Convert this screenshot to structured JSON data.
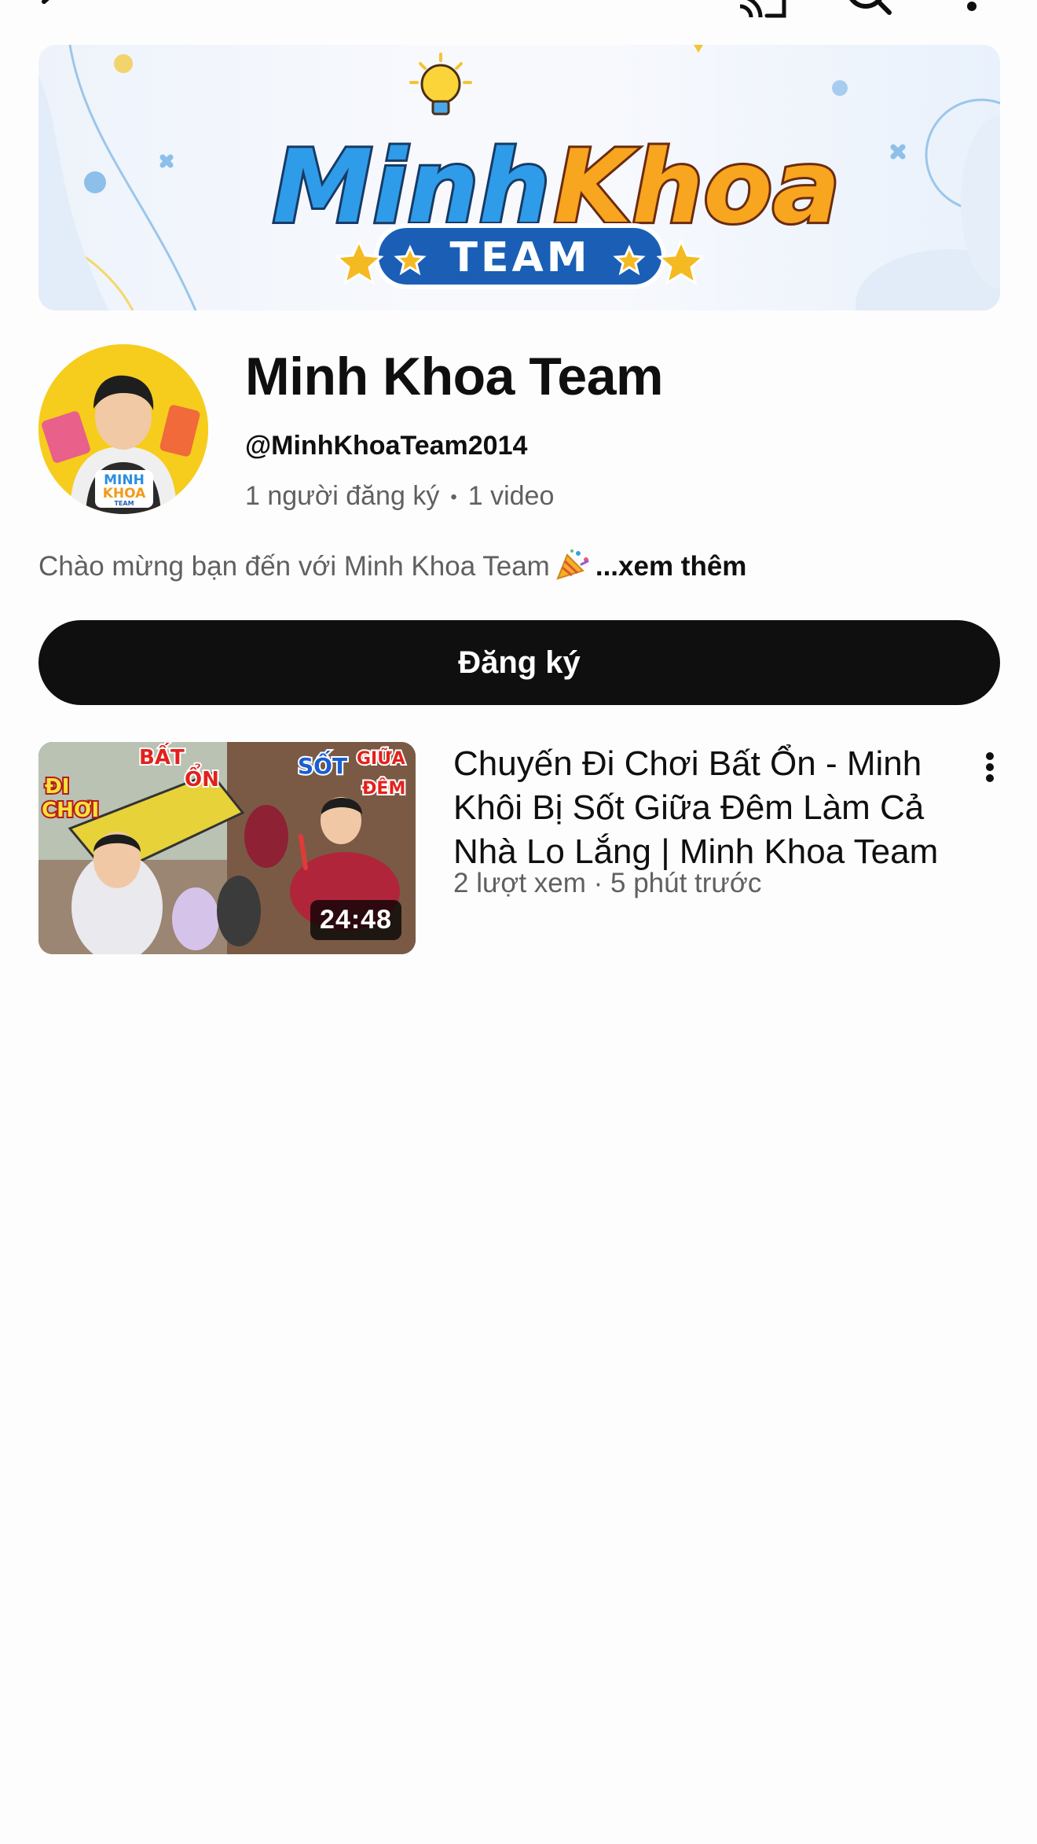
{
  "topbar": {
    "icons": [
      "back-icon",
      "cast-icon",
      "search-icon",
      "more-vert-icon"
    ]
  },
  "banner": {
    "logo_word_1": "Minh",
    "logo_word_2": "Khoa",
    "logo_ribbon": "TEAM"
  },
  "avatar": {
    "badge_line_1": "MINH",
    "badge_line_2": "KHOA",
    "badge_line_3": "TEAM"
  },
  "channel": {
    "name": "Minh Khoa Team",
    "handle": "@MinhKhoaTeam2014",
    "subscribers": "1 người đăng ký",
    "separator": "•",
    "video_count": "1 video",
    "description": "Chào mừng bạn đến với Minh Khoa Team",
    "description_emoji": "party-popper-icon",
    "more_label": "...xem thêm"
  },
  "subscribe_label": "Đăng ký",
  "videos": [
    {
      "title": "Chuyến Đi Chơi Bất Ổn - Minh Khôi Bị Sốt Giữa Đêm Làm Cả Nhà Lo Lắng | Minh Khoa Team",
      "meta": "2 lượt xem · 5 phút trước",
      "duration": "24:48",
      "thumb_text_1": "ĐI",
      "thumb_text_2": "CHƠI",
      "thumb_text_3": "BẤT",
      "thumb_text_4": "ỔN",
      "thumb_text_5": "SỐT",
      "thumb_text_6": "GIỮA",
      "thumb_text_7": "ĐÊM"
    }
  ],
  "colors": {
    "accent": "#0f0f0f",
    "secondary_text": "#606060",
    "background": "#fdfdfd",
    "logo_blue": "#2b9be8",
    "logo_orange": "#f7a21b",
    "avatar_bg": "#f6cd1c"
  }
}
